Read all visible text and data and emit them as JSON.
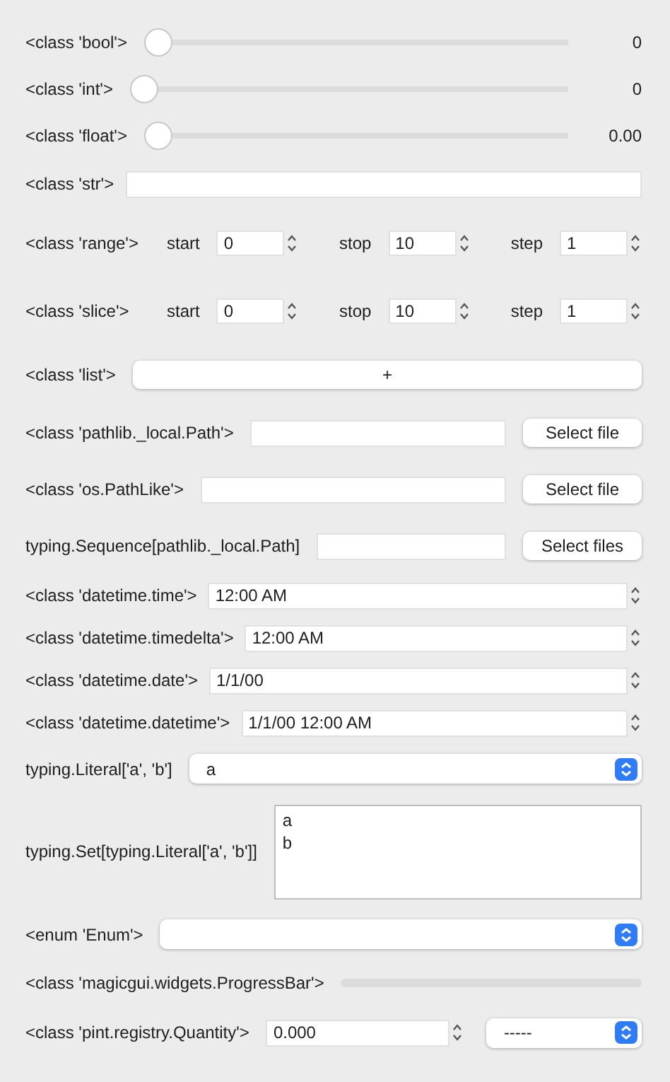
{
  "rows": [
    {
      "kind": "slider",
      "label": "<class 'bool'>",
      "reading": "0",
      "level": 0
    },
    {
      "kind": "slider",
      "label": "<class 'int'>",
      "reading": "0",
      "level": 0
    },
    {
      "kind": "slider",
      "label": "<class 'float'>",
      "reading": "0.00",
      "level": 0
    },
    {
      "kind": "text",
      "label": "<class 'str'>"
    },
    {
      "kind": "range",
      "label": "<class 'range'>",
      "fields": [
        {
          "label": "start",
          "value": "0"
        },
        {
          "label": "stop",
          "value": "10"
        },
        {
          "label": "step",
          "value": "1"
        }
      ]
    },
    {
      "kind": "range",
      "label": "<class 'slice'>",
      "fields": [
        {
          "label": "start",
          "value": "0"
        },
        {
          "label": "stop",
          "value": "10"
        },
        {
          "label": "step",
          "value": "1"
        }
      ]
    },
    {
      "kind": "add",
      "label": "<class 'list'>",
      "button": "+"
    },
    {
      "kind": "file",
      "label": "<class 'pathlib._local.Path'>",
      "button": "Select file"
    },
    {
      "kind": "file",
      "label": "<class 'os.PathLike'>",
      "button": "Select file"
    },
    {
      "kind": "file",
      "label": "typing.Sequence[pathlib._local.Path]",
      "button": "Select files"
    },
    {
      "kind": "spin",
      "label": "<class 'datetime.time'>",
      "value": "12:00 AM"
    },
    {
      "kind": "spin",
      "label": "<class 'datetime.timedelta'>",
      "value": "12:00 AM"
    },
    {
      "kind": "spin",
      "label": "<class 'datetime.date'>",
      "value": "1/1/00"
    },
    {
      "kind": "spin",
      "label": "<class 'datetime.datetime'>",
      "value": "1/1/00 12:00 AM"
    },
    {
      "kind": "select",
      "label": "typing.Literal['a', 'b']",
      "value": "a"
    },
    {
      "kind": "listbox",
      "label": "typing.Set[typing.Literal['a', 'b']]",
      "items": [
        "a",
        "b"
      ]
    },
    {
      "kind": "select",
      "label": "<enum 'Enum'>"
    },
    {
      "kind": "progress",
      "label": "<class 'magicgui.widgets.ProgressBar'>",
      "level": 0
    },
    {
      "kind": "quantity",
      "label": "<class 'pint.registry.Quantity'>",
      "value": "0.000",
      "unit": "-----"
    }
  ]
}
